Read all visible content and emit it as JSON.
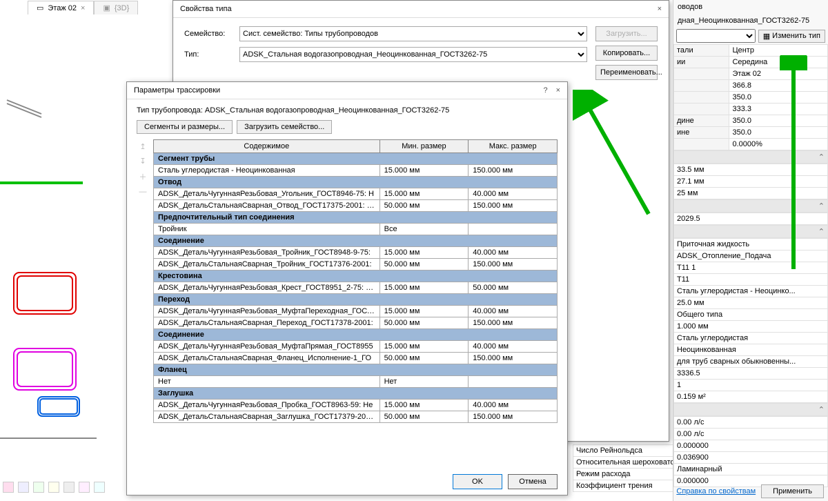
{
  "tabs": [
    {
      "icon": "floor-icon",
      "label": "Этаж 02",
      "closable": true
    },
    {
      "icon": "3d-icon",
      "label": "{3D}",
      "closable": false
    }
  ],
  "type_dialog": {
    "title": "Свойства типа",
    "family_label": "Семейство:",
    "family_value": "Сист. семейство: Типы трубопроводов",
    "type_label": "Тип:",
    "type_value": "ADSK_Стальная водогазопроводная_Неоцинкованная_ГОСТ3262-75",
    "load_btn": "Загрузить...",
    "copy_btn": "Копировать...",
    "rename_btn": "Переименовать..."
  },
  "trace_dialog": {
    "title": "Параметры трассировки",
    "pipe_type_label": "Тип трубопровода:",
    "pipe_type_value": "ADSK_Стальная водогазопроводная_Неоцинкованная_ГОСТ3262-75",
    "segments_btn": "Сегменты и размеры...",
    "load_family_btn": "Загрузить семейство...",
    "columns": [
      "Содержимое",
      "Мин. размер",
      "Макс. размер"
    ],
    "rows": [
      {
        "section": "Сегмент трубы"
      },
      {
        "c": "Сталь углеродистая - Неоцинкованная",
        "min": "15.000 мм",
        "max": "150.000 мм"
      },
      {
        "section": "Отвод"
      },
      {
        "c": "ADSK_ДетальЧугуннаяРезьбовая_Угольник_ГОСТ8946-75: Н",
        "min": "15.000 мм",
        "max": "40.000 мм"
      },
      {
        "c": "ADSK_ДетальСтальнаяСварная_Отвод_ГОСТ17375-2001: Ис",
        "min": "50.000 мм",
        "max": "150.000 мм"
      },
      {
        "section": "Предпочтительный тип соединения"
      },
      {
        "c": "Тройник",
        "min": "Все",
        "max": ""
      },
      {
        "section": "Соединение"
      },
      {
        "c": "ADSK_ДетальЧугуннаяРезьбовая_Тройник_ГОСТ8948-9-75:",
        "min": "15.000 мм",
        "max": "40.000 мм"
      },
      {
        "c": "ADSK_ДетальСтальнаяСварная_Тройник_ГОСТ17376-2001:",
        "min": "50.000 мм",
        "max": "150.000 мм"
      },
      {
        "section": "Крестовина"
      },
      {
        "c": "ADSK_ДетальЧугуннаяРезьбовая_Крест_ГОСТ8951_2-75: Не",
        "min": "15.000 мм",
        "max": "50.000 мм"
      },
      {
        "section": "Переход"
      },
      {
        "c": "ADSK_ДетальЧугуннаяРезьбовая_МуфтаПереходная_ГОСТ8",
        "min": "15.000 мм",
        "max": "40.000 мм"
      },
      {
        "c": "ADSK_ДетальСтальнаяСварная_Переход_ГОСТ17378-2001:",
        "min": "50.000 мм",
        "max": "150.000 мм"
      },
      {
        "section": "Соединение"
      },
      {
        "c": "ADSK_ДетальЧугуннаяРезьбовая_МуфтаПрямая_ГОСТ8955",
        "min": "15.000 мм",
        "max": "40.000 мм"
      },
      {
        "c": "ADSK_ДетальСтальнаяСварная_Фланец_Исполнение-1_ГО",
        "min": "50.000 мм",
        "max": "150.000 мм"
      },
      {
        "section": "Фланец"
      },
      {
        "c": "Нет",
        "min": "Нет",
        "max": ""
      },
      {
        "section": "Заглушка"
      },
      {
        "c": "ADSK_ДетальЧугуннаяРезьбовая_Пробка_ГОСТ8963-59: Не",
        "min": "15.000 мм",
        "max": "40.000 мм"
      },
      {
        "c": "ADSK_ДетальСтальнаяСварная_Заглушка_ГОСТ17379-2001:",
        "min": "50.000 мм",
        "max": "150.000 мм"
      }
    ],
    "ok": "OK",
    "cancel": "Отмена"
  },
  "right_panel": {
    "head1": "оводов",
    "head2": "дная_Неоцинкованная_ГОСТ3262-75",
    "edit_type": "Изменить тип",
    "props": [
      {
        "l": "тали",
        "v": "Центр"
      },
      {
        "l": "ии",
        "v": "Середина"
      },
      {
        "l": "",
        "v": "Этаж 02"
      },
      {
        "l": "",
        "v": "366.8"
      },
      {
        "l": "",
        "v": "350.0"
      },
      {
        "l": "",
        "v": "333.3"
      },
      {
        "l": "дине",
        "v": "350.0"
      },
      {
        "l": "ине",
        "v": "350.0"
      },
      {
        "l": "",
        "v": "0.0000%"
      }
    ],
    "props2": [
      {
        "v": "33.5 мм"
      },
      {
        "v": "27.1 мм"
      },
      {
        "v": "25 мм"
      }
    ],
    "props3": [
      {
        "v": "2029.5"
      }
    ],
    "props4": [
      {
        "v": "Приточная жидкость"
      },
      {
        "v": "ADSK_Отопление_Подача"
      },
      {
        "v": "Т11 1"
      },
      {
        "v": "Т11"
      },
      {
        "v": "Сталь углеродистая - Неоцинко..."
      },
      {
        "v": "25.0 мм"
      },
      {
        "v": "Общего типа"
      },
      {
        "v": "1.000 мм"
      },
      {
        "v": "Сталь углеродистая"
      },
      {
        "v": "Неоцинкованная"
      },
      {
        "v": "для труб сварных обыкновенны..."
      },
      {
        "v": "3336.5"
      },
      {
        "v": "1"
      },
      {
        "v": "0.159 м²"
      }
    ],
    "props5": [
      {
        "v": "0.00 л/с"
      },
      {
        "v": "0.00 л/с"
      },
      {
        "v": "0.000000"
      },
      {
        "v": "0.036900"
      },
      {
        "v": "Ламинарный"
      },
      {
        "v": "0.000000"
      }
    ]
  },
  "lower_labels": {
    "reyn": "Число Рейнольдса",
    "rough": "Относительная шероховатость",
    "flow": "Режим расхода",
    "friction": "Коэффициент трения"
  },
  "mid_buttons": {
    "cancel": "Отмена",
    "apply": "Применить"
  },
  "help_link": "Справка по свойствам",
  "apply_btn": "Применить"
}
